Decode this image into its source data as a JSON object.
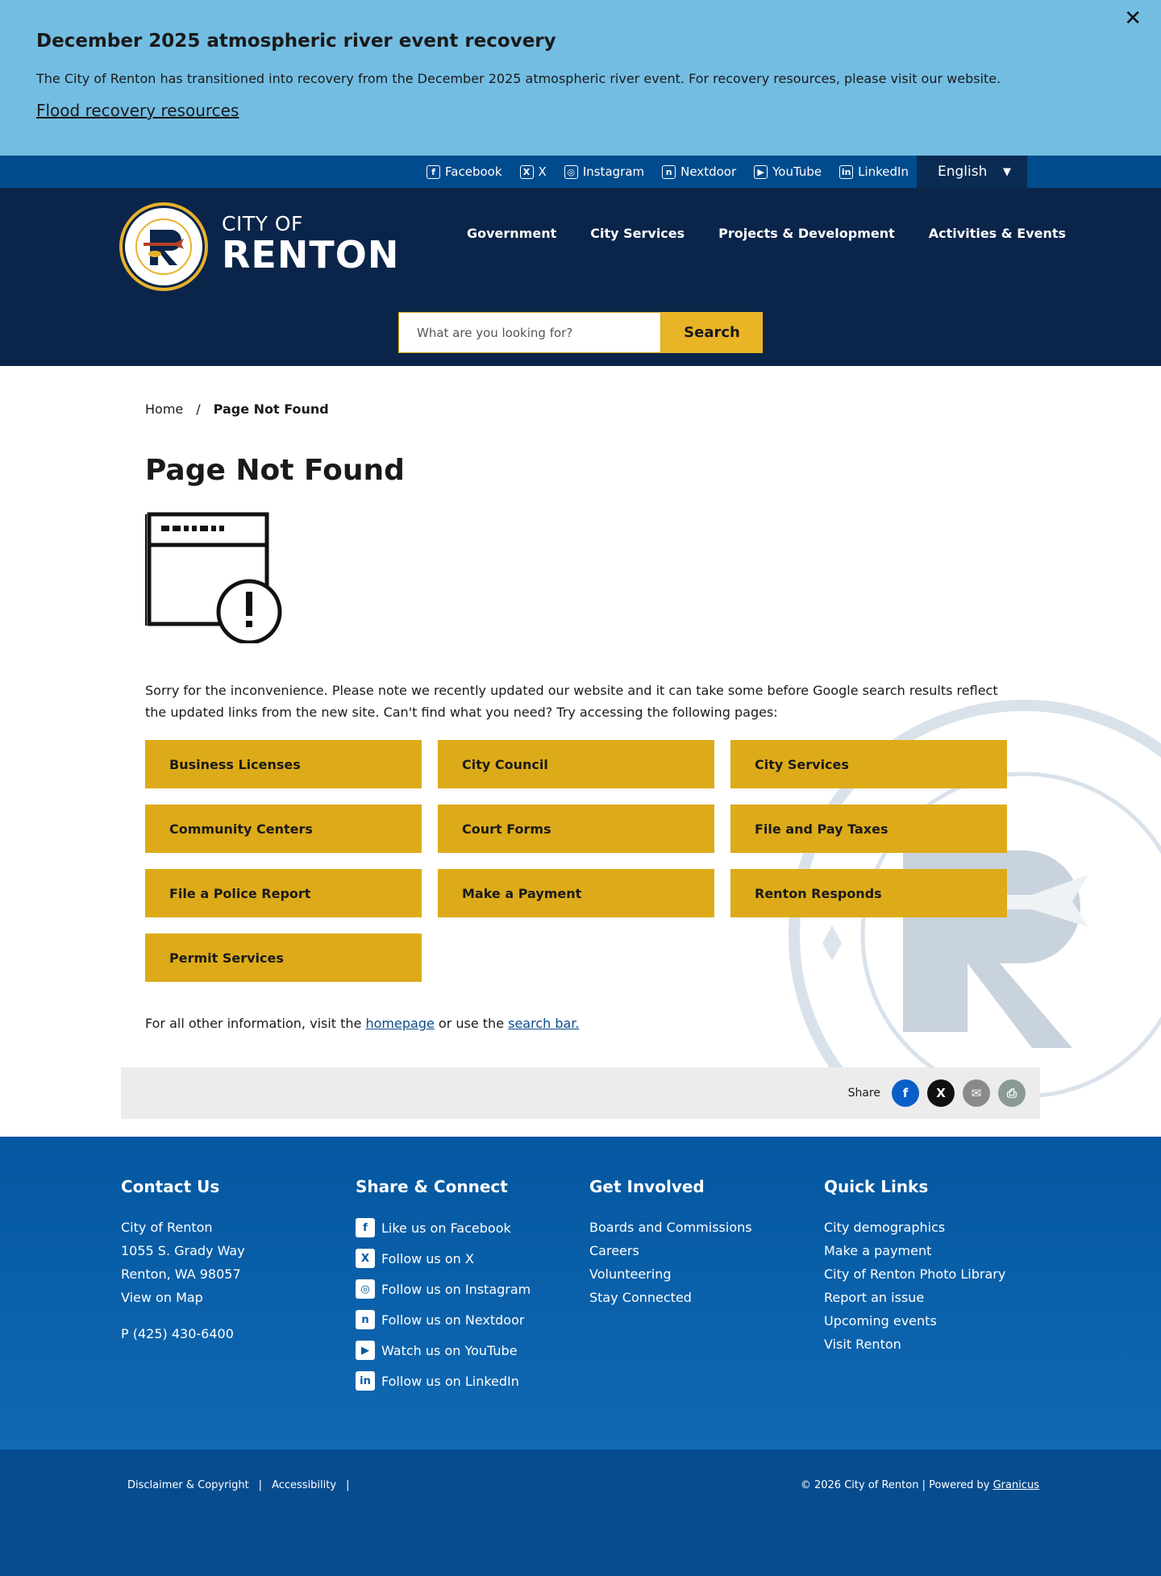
{
  "alert": {
    "title": "December 2025 atmospheric river event recovery",
    "text": "The City of Renton has transitioned into recovery from the December 2025 atmospheric river event. For recovery resources, please visit our website.",
    "link": "Flood recovery resources",
    "close": "✕"
  },
  "social": [
    {
      "label": "Facebook",
      "icon": "f"
    },
    {
      "label": "X",
      "icon": "X"
    },
    {
      "label": "Instagram",
      "icon": "◎"
    },
    {
      "label": "Nextdoor",
      "icon": "n"
    },
    {
      "label": "YouTube",
      "icon": "▶"
    },
    {
      "label": "LinkedIn",
      "icon": "in"
    }
  ],
  "language": {
    "label": "English",
    "caret": "▼"
  },
  "logo": {
    "city_of": "CITY OF",
    "renton": "RENTON",
    "seal_text": "CITY OF RENTON"
  },
  "nav": [
    "Government",
    "City Services",
    "Projects & Development",
    "Activities & Events"
  ],
  "search": {
    "placeholder": "What are you looking for?",
    "button": "Search"
  },
  "breadcrumb": {
    "home": "Home",
    "sep": "/",
    "current": "Page Not Found"
  },
  "page": {
    "title": "Page Not Found",
    "intro": "Sorry for the inconvenience. Please note we recently updated our website and it can take some before Google search results reflect the updated links from the new site. Can't find what you need? Try accessing the following pages:",
    "buttons": [
      "Business Licenses",
      "City Council",
      "City Services",
      "Community Centers",
      "Court Forms",
      "File and Pay Taxes",
      "File a Police Report",
      "Make a Payment",
      "Renton Responds",
      "Permit Services"
    ],
    "other_prefix": "For all other information, visit the ",
    "other_homepage": "homepage",
    "other_mid": " or use the ",
    "other_search": "search bar."
  },
  "share": {
    "label": "Share",
    "colors": {
      "facebook": "#0a5ec8",
      "x": "#111111",
      "email": "#8a8a8a",
      "print": "#8a9a96"
    }
  },
  "footer": {
    "contact": {
      "heading": "Contact Us",
      "name": "City of Renton",
      "street": "1055 S. Grady Way",
      "city": "Renton, WA 98057",
      "map": "View on Map",
      "phone_prefix": "P ",
      "phone": "(425) 430-6400"
    },
    "share_connect": {
      "heading": "Share & Connect",
      "items": [
        {
          "label": "Like us on Facebook",
          "icon": "f"
        },
        {
          "label": "Follow us on X",
          "icon": "X"
        },
        {
          "label": "Follow us on Instagram",
          "icon": "◎"
        },
        {
          "label": "Follow us on Nextdoor",
          "icon": "n"
        },
        {
          "label": "Watch us on YouTube",
          "icon": "▶"
        },
        {
          "label": "Follow us on LinkedIn",
          "icon": "in"
        }
      ]
    },
    "get_involved": {
      "heading": "Get Involved",
      "items": [
        "Boards and Commissions",
        "Careers",
        "Volunteering",
        "Stay Connected"
      ]
    },
    "quick_links": {
      "heading": "Quick Links",
      "items": [
        "City demographics",
        "Make a payment",
        "City of Renton Photo Library",
        "Report an issue",
        "Upcoming events",
        "Visit Renton"
      ]
    }
  },
  "subfooter": {
    "disclaimer": "Disclaimer & Copyright",
    "accessibility": "Accessibility",
    "sep": "|",
    "copyright": "© 2026 City of Renton | Powered by ",
    "granicus": "Granicus"
  },
  "colors": {
    "alert_bg": "#73bde3",
    "header_bg": "#0a2549",
    "accent_gold": "#ddab19",
    "footer_blue": "#0357a0"
  }
}
